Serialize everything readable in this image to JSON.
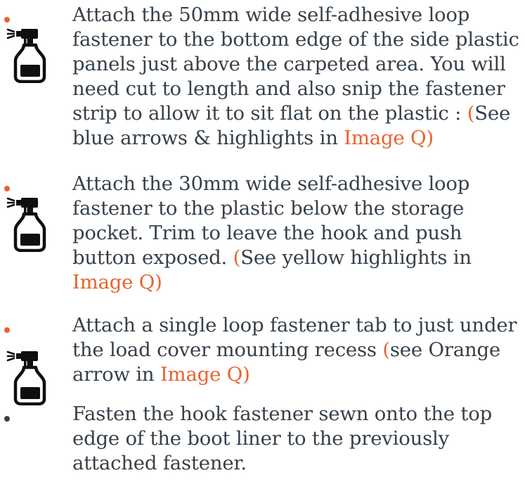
{
  "colors": {
    "text": "#35404a",
    "accent": "#e8632b",
    "bullet_accent": "#e8632b",
    "bullet_plain": "#35404a",
    "icon": "#0f0f0f"
  },
  "items": [
    {
      "icon": "spray-bottle-icon",
      "lines": [
        [
          {
            "t": "Attach the 50mm wide self-adhesive loop"
          }
        ],
        [
          {
            "t": "fastener to the bottom edge of the side plastic"
          }
        ],
        [
          {
            "t": "panels just above the carpeted area. You will"
          }
        ],
        [
          {
            "t": "need cut to length and also snip the fastener"
          }
        ],
        [
          {
            "t": "strip to allow it to sit flat on the plastic : "
          },
          {
            "t": "(",
            "accent": true
          },
          {
            "t": "See"
          }
        ],
        [
          {
            "t": "blue arrows & highlights in "
          },
          {
            "t": "Image Q)",
            "accent": true
          }
        ]
      ]
    },
    {
      "icon": "spray-bottle-icon",
      "lines": [
        [
          {
            "t": "Attach the 30mm wide self-adhesive loop"
          }
        ],
        [
          {
            "t": "fastener to the plastic below the storage"
          }
        ],
        [
          {
            "t": "pocket. Trim to leave the hook and push"
          }
        ],
        [
          {
            "t": "button exposed. "
          },
          {
            "t": "(",
            "accent": true
          },
          {
            "t": "See yellow highlights in"
          }
        ],
        [
          {
            "t": "Image Q)",
            "accent": true
          }
        ]
      ]
    },
    {
      "icon": "spray-bottle-icon",
      "lines": [
        [
          {
            "t": "Attach a single loop fastener tab to just under"
          }
        ],
        [
          {
            "t": "the load cover mounting recess "
          },
          {
            "t": "(",
            "accent": true
          },
          {
            "t": "see Orange"
          }
        ],
        [
          {
            "t": "arrow in "
          },
          {
            "t": "Image Q)",
            "accent": true
          }
        ]
      ]
    },
    {
      "icon": "",
      "lines": [
        [
          {
            "t": "Fasten the hook fastener sewn onto the top"
          }
        ],
        [
          {
            "t": "edge of the boot liner to the previously"
          }
        ],
        [
          {
            "t": "attached fastener."
          }
        ]
      ]
    }
  ]
}
